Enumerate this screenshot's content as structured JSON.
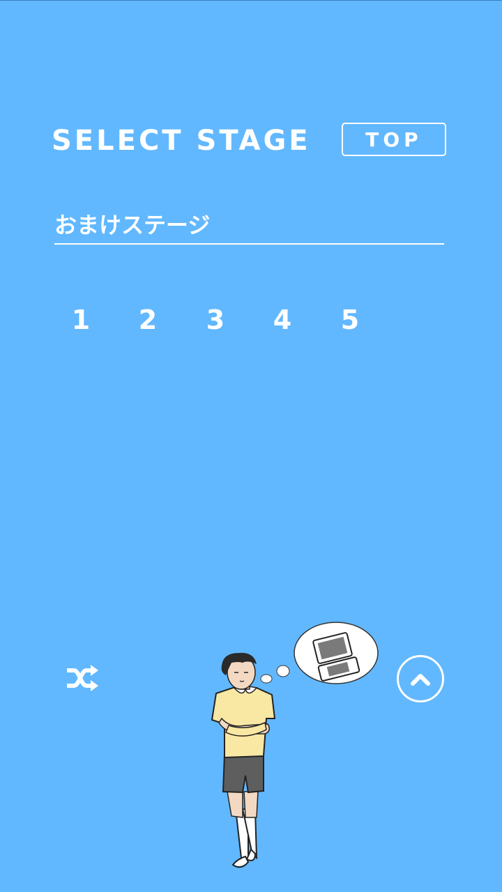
{
  "header": {
    "title": "SELECT STAGE",
    "top_button_label": "TOP"
  },
  "section": {
    "title": "おまけステージ"
  },
  "stages": [
    {
      "label": "1"
    },
    {
      "label": "2"
    },
    {
      "label": "3"
    },
    {
      "label": "4"
    },
    {
      "label": "5"
    }
  ],
  "controls": {
    "shuffle_icon": "shuffle-icon",
    "up_icon": "chevron-up-icon"
  },
  "illustration": {
    "subject": "boy-crossing-arms",
    "thought": "handheld-game-console"
  },
  "colors": {
    "background": "#62b8fe",
    "foreground": "#ffffff",
    "shirt": "#f9e7a4",
    "shorts": "#5e5e5e"
  }
}
